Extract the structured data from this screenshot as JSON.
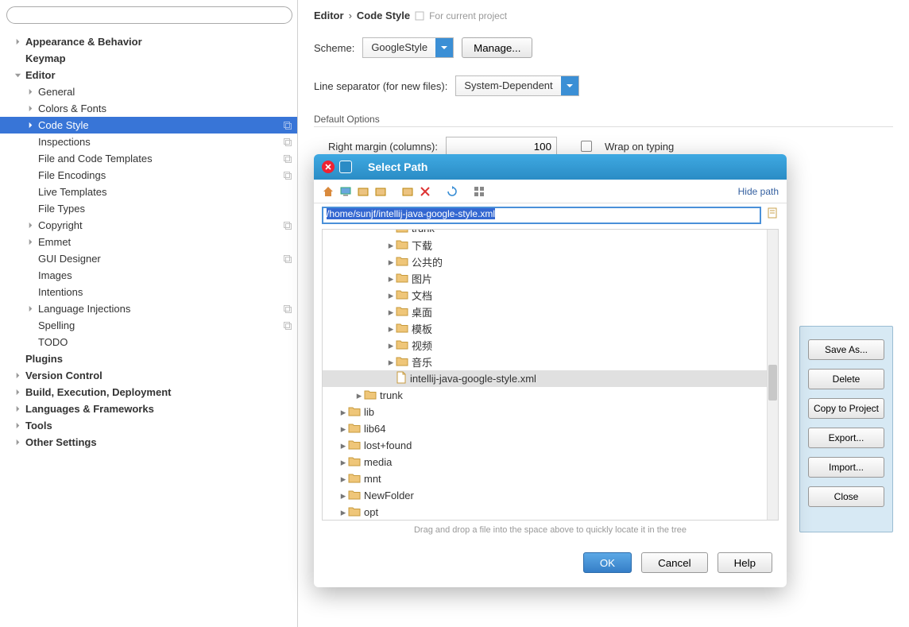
{
  "search": {
    "placeholder": ""
  },
  "sidebar": {
    "items": [
      {
        "label": "Appearance & Behavior",
        "depth": 1,
        "caret": "right",
        "bold": true
      },
      {
        "label": "Keymap",
        "depth": 1,
        "caret": "",
        "bold": true
      },
      {
        "label": "Editor",
        "depth": 1,
        "caret": "down",
        "bold": true
      },
      {
        "label": "General",
        "depth": 2,
        "caret": "right"
      },
      {
        "label": "Colors & Fonts",
        "depth": 2,
        "caret": "right"
      },
      {
        "label": "Code Style",
        "depth": 2,
        "caret": "right",
        "selected": true,
        "ind": true
      },
      {
        "label": "Inspections",
        "depth": 2,
        "caret": "",
        "ind": true
      },
      {
        "label": "File and Code Templates",
        "depth": 2,
        "caret": "",
        "ind": true
      },
      {
        "label": "File Encodings",
        "depth": 2,
        "caret": "",
        "ind": true
      },
      {
        "label": "Live Templates",
        "depth": 2,
        "caret": ""
      },
      {
        "label": "File Types",
        "depth": 2,
        "caret": ""
      },
      {
        "label": "Copyright",
        "depth": 2,
        "caret": "right",
        "ind": true
      },
      {
        "label": "Emmet",
        "depth": 2,
        "caret": "right"
      },
      {
        "label": "GUI Designer",
        "depth": 2,
        "caret": "",
        "ind": true
      },
      {
        "label": "Images",
        "depth": 2,
        "caret": ""
      },
      {
        "label": "Intentions",
        "depth": 2,
        "caret": ""
      },
      {
        "label": "Language Injections",
        "depth": 2,
        "caret": "right",
        "ind": true
      },
      {
        "label": "Spelling",
        "depth": 2,
        "caret": "",
        "ind": true
      },
      {
        "label": "TODO",
        "depth": 2,
        "caret": ""
      },
      {
        "label": "Plugins",
        "depth": 1,
        "caret": "",
        "bold": true
      },
      {
        "label": "Version Control",
        "depth": 1,
        "caret": "right",
        "bold": true
      },
      {
        "label": "Build, Execution, Deployment",
        "depth": 1,
        "caret": "right",
        "bold": true
      },
      {
        "label": "Languages & Frameworks",
        "depth": 1,
        "caret": "right",
        "bold": true
      },
      {
        "label": "Tools",
        "depth": 1,
        "caret": "right",
        "bold": true
      },
      {
        "label": "Other Settings",
        "depth": 1,
        "caret": "right",
        "bold": true
      }
    ]
  },
  "breadcrumb": {
    "a": "Editor",
    "b": "Code Style",
    "note": "For current project"
  },
  "scheme": {
    "label": "Scheme:",
    "value": "GoogleStyle",
    "manage": "Manage..."
  },
  "linesep": {
    "label": "Line separator (for new files):",
    "value": "System-Dependent"
  },
  "defaults": {
    "title": "Default Options",
    "margin_label": "Right margin (columns):",
    "margin_value": "100",
    "wrap": "Wrap on typing"
  },
  "sidepanel": {
    "save_as": "Save As...",
    "delete": "Delete",
    "copy": "Copy to Project",
    "export": "Export...",
    "import": "Import...",
    "close": "Close"
  },
  "dialog": {
    "title": "Select Path",
    "hide_path": "Hide path",
    "path": "/home/sunjf/intellij-java-google-style.xml",
    "tree": [
      {
        "label": "trunk",
        "depth": 4,
        "folder": true,
        "top_cut": true
      },
      {
        "label": "下载",
        "depth": 4,
        "caret": "right",
        "folder": true
      },
      {
        "label": "公共的",
        "depth": 4,
        "caret": "right",
        "folder": true
      },
      {
        "label": "图片",
        "depth": 4,
        "caret": "right",
        "folder": true
      },
      {
        "label": "文档",
        "depth": 4,
        "caret": "right",
        "folder": true
      },
      {
        "label": "桌面",
        "depth": 4,
        "caret": "right",
        "folder": true
      },
      {
        "label": "模板",
        "depth": 4,
        "caret": "right",
        "folder": true
      },
      {
        "label": "视频",
        "depth": 4,
        "caret": "right",
        "folder": true
      },
      {
        "label": "音乐",
        "depth": 4,
        "caret": "right",
        "folder": true
      },
      {
        "label": "intellij-java-google-style.xml",
        "depth": 4,
        "file": true,
        "selected": true
      },
      {
        "label": "trunk",
        "depth": 2,
        "caret": "right",
        "folder": true
      },
      {
        "label": "lib",
        "depth": 1,
        "caret": "right",
        "folder": true
      },
      {
        "label": "lib64",
        "depth": 1,
        "caret": "right",
        "folder": true
      },
      {
        "label": "lost+found",
        "depth": 1,
        "caret": "right",
        "folder": true
      },
      {
        "label": "media",
        "depth": 1,
        "caret": "right",
        "folder": true
      },
      {
        "label": "mnt",
        "depth": 1,
        "caret": "right",
        "folder": true
      },
      {
        "label": "NewFolder",
        "depth": 1,
        "caret": "right",
        "folder": true
      },
      {
        "label": "opt",
        "depth": 1,
        "caret": "right",
        "folder": true
      }
    ],
    "hint": "Drag and drop a file into the space above to quickly locate it in the tree",
    "ok": "OK",
    "cancel": "Cancel",
    "help": "Help"
  }
}
